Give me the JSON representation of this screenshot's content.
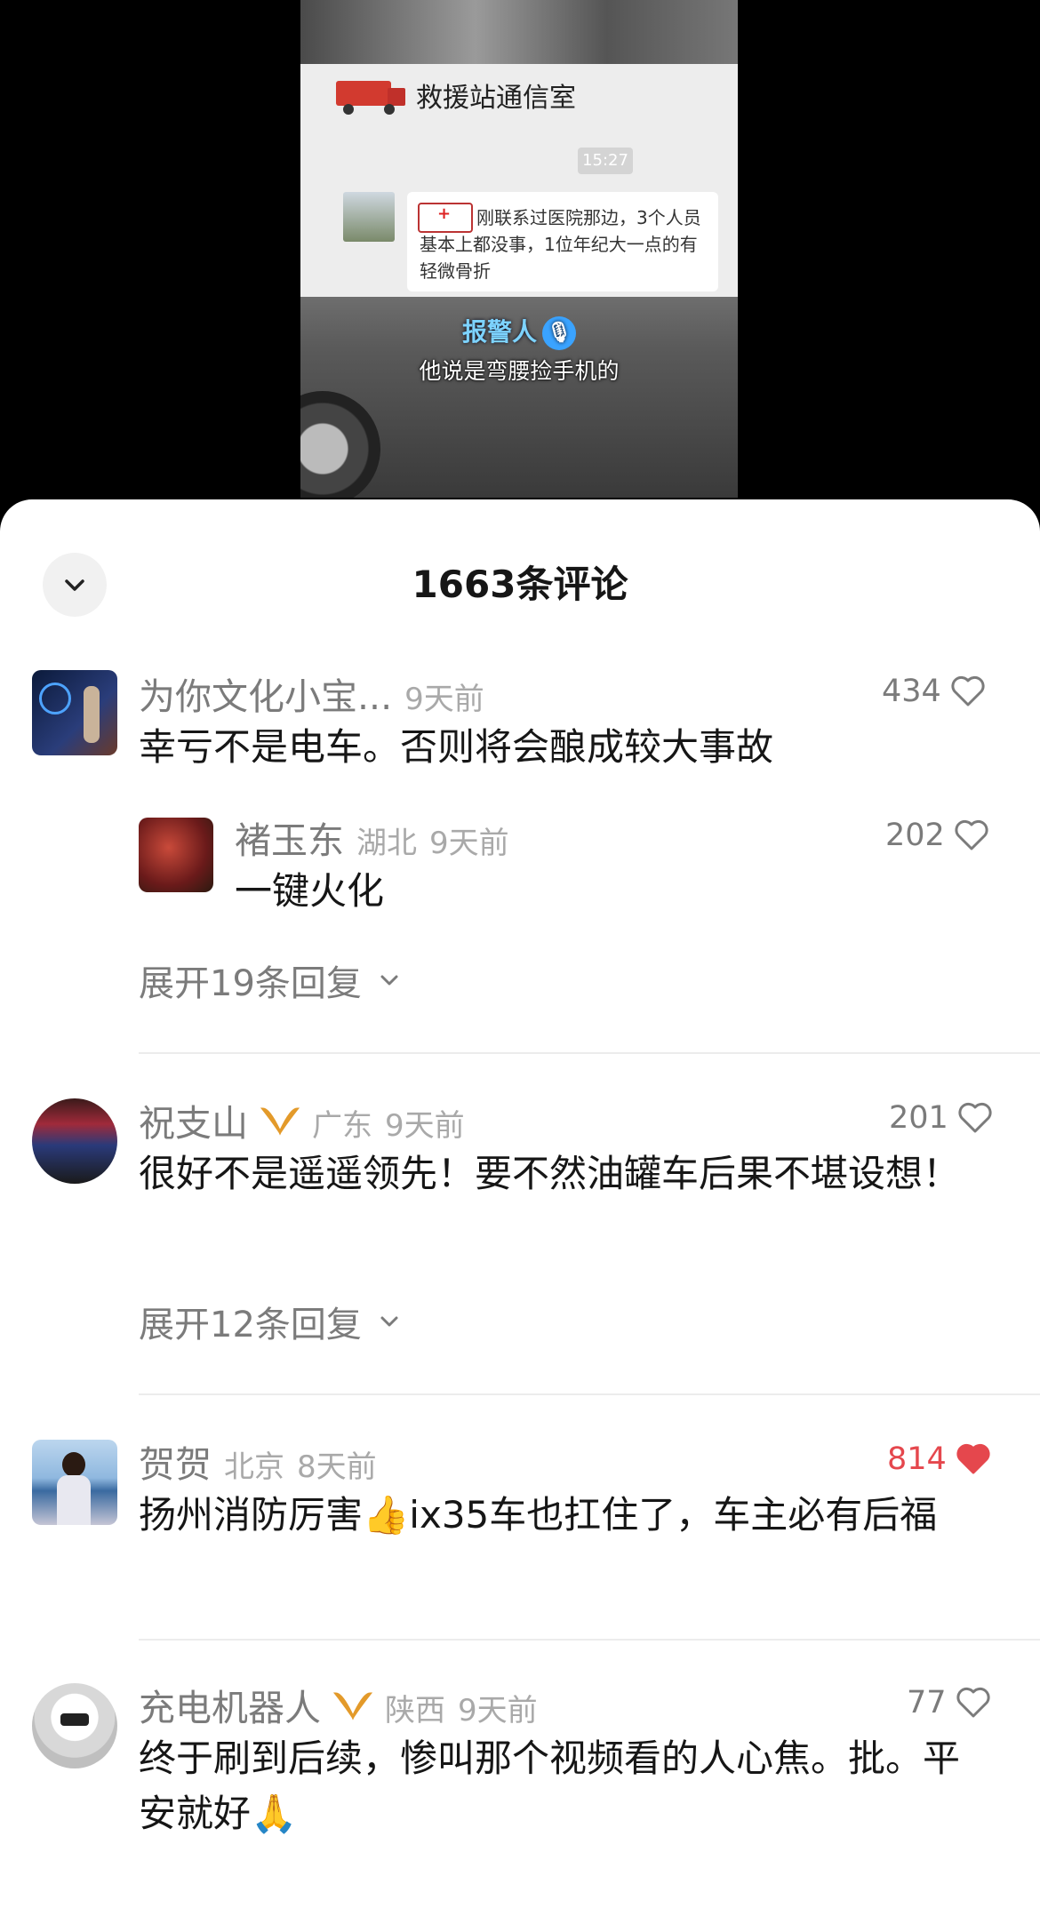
{
  "video": {
    "chat_title": "救援站通信室",
    "chat_time": "15:27",
    "chat_message": "刚联系过医院那边，3个人员基本上都没事，1位年纪大一点的有轻微骨折",
    "speaker_label": "报警人",
    "caption": "他说是弯腰捡手机的"
  },
  "sheet": {
    "title": "1663条评论"
  },
  "comments": [
    {
      "author": "为你文化小宝...",
      "time": "9天前",
      "text": "幸亏不是电车。否则将会酿成较大事故",
      "likes": "434",
      "reply": {
        "author": "褚玉东",
        "location": "湖北",
        "time": "9天前",
        "text": "一键火化",
        "likes": "202"
      },
      "expand": "展开19条回复"
    },
    {
      "author": "祝支山",
      "location": "广东",
      "time": "9天前",
      "text": "很好不是遥遥领先！要不然油罐车后果不堪设想！",
      "likes": "201",
      "expand": "展开12条回复"
    },
    {
      "author": "贺贺",
      "location": "北京",
      "time": "8天前",
      "text": "扬州消防厉害👍ix35车也扛住了，车主必有后福",
      "likes": "814",
      "liked": true
    },
    {
      "author": "充电机器人",
      "location": "陕西",
      "time": "9天前",
      "text": "终于刷到后续，惨叫那个视频看的人心焦。批。平安就好🙏",
      "likes": "77"
    }
  ],
  "colors": {
    "accent_like": "#e5474d",
    "badge": "#e39a2a"
  }
}
